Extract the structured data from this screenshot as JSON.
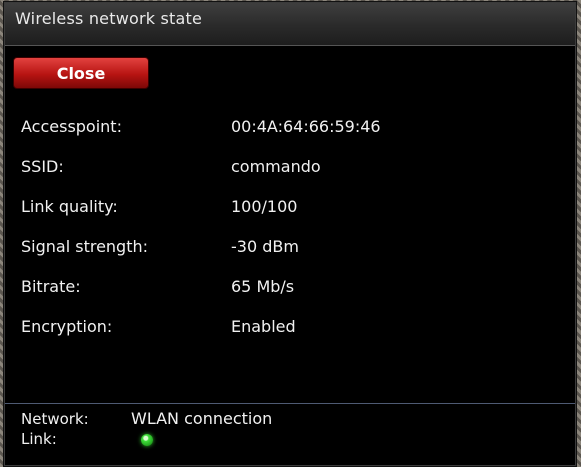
{
  "window": {
    "title": "Wireless network state",
    "close_label": "Close"
  },
  "details": [
    {
      "label": "Accesspoint:",
      "value": "00:4A:64:66:59:46"
    },
    {
      "label": "SSID:",
      "value": "commando"
    },
    {
      "label": "Link quality:",
      "value": "100/100"
    },
    {
      "label": "Signal strength:",
      "value": "-30 dBm"
    },
    {
      "label": "Bitrate:",
      "value": "65 Mb/s"
    },
    {
      "label": "Encryption:",
      "value": "Enabled"
    }
  ],
  "footer": {
    "network_label": "Network:",
    "network_value": "WLAN connection",
    "link_label": "Link:",
    "link_status": "connected",
    "link_color": "#3fe03a"
  }
}
